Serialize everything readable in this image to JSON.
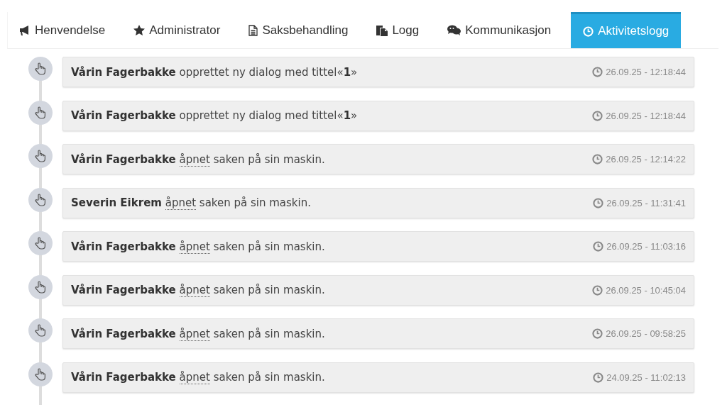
{
  "tabs": [
    {
      "label": "Henvendelse",
      "selected": false
    },
    {
      "label": "Administrator",
      "selected": false
    },
    {
      "label": "Saksbehandling",
      "selected": false
    },
    {
      "label": "Logg",
      "selected": false
    },
    {
      "label": "Kommunikasjon",
      "selected": false
    },
    {
      "label": "Aktivitetslogg",
      "selected": true
    }
  ],
  "activity_log": [
    {
      "actor": "Vårin Fagerbakke",
      "text": "opprettet ny dialog med tittel«**1**»",
      "time": "26.09.25 - 12:18:44"
    },
    {
      "actor": "Vårin Fagerbakke",
      "text": "opprettet ny dialog med tittel«**1**»",
      "time": "26.09.25 - 12:18:44"
    },
    {
      "actor": "Vårin Fagerbakke",
      "link": "åpnet",
      "text": "saken på sin maskin.",
      "time": "26.09.25 - 12:14:22"
    },
    {
      "actor": "Severin Eikrem",
      "link": "åpnet",
      "text": "saken på sin maskin.",
      "time": "26.09.25 - 11:31:41"
    },
    {
      "actor": "Vårin Fagerbakke",
      "link": "åpnet",
      "text": "saken på sin maskin.",
      "time": "26.09.25 - 11:03:16"
    },
    {
      "actor": "Vårin Fagerbakke",
      "link": "åpnet",
      "text": "saken på sin maskin.",
      "time": "26.09.25 - 10:45:04"
    },
    {
      "actor": "Vårin Fagerbakke",
      "link": "åpnet",
      "text": "saken på sin maskin.",
      "time": "26.09.25 - 09:58:25"
    },
    {
      "actor": "Vårin Fagerbakke",
      "link": "åpnet",
      "text": "saken på sin maskin.",
      "time": "24.09.25 - 11:02:13"
    }
  ]
}
